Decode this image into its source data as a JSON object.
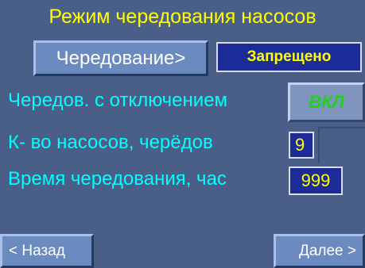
{
  "header": {
    "title": "Режим чередования насосов"
  },
  "mode": {
    "button_label": "Чередование>",
    "status": "Запрещено"
  },
  "settings": {
    "shutdown_rotation": {
      "label": "Чередов. с отключением",
      "value": "ВКЛ"
    },
    "pump_count": {
      "label": "К- во насосов, черёдов",
      "value": "9"
    },
    "rotation_time": {
      "label": "Время чередования, час",
      "value": "999"
    }
  },
  "nav": {
    "back_label": "< Назад",
    "next_label": "Далее >"
  },
  "colors": {
    "background": "#4a5f88",
    "title": "#ffff00",
    "label": "#00ffff",
    "on_state": "#1fd21f",
    "value_box": "#1b2c99"
  }
}
